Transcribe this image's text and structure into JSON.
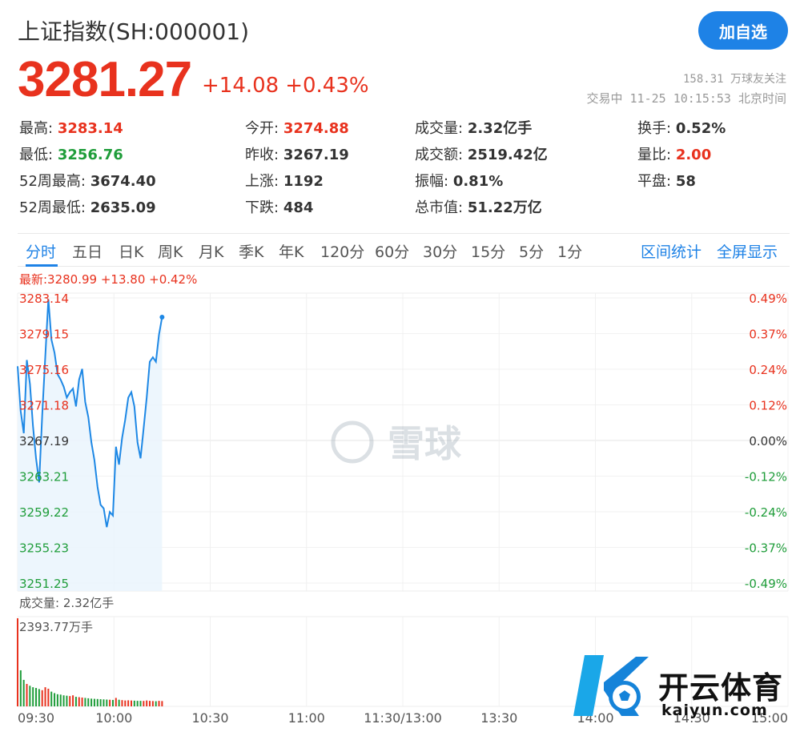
{
  "header": {
    "title": "上证指数(SH:000001)",
    "follow_button": "加自选",
    "price": "3281.27",
    "change": "+14.08",
    "change_pct": "+0.43%",
    "followers": "158.31 万球友关注",
    "status": "交易中 11-25 10:15:53 北京时间"
  },
  "stats": [
    {
      "label": "最高:",
      "value": "3283.14",
      "color": "red"
    },
    {
      "label": "今开:",
      "value": "3274.88",
      "color": "red"
    },
    {
      "label": "成交量:",
      "value": "2.32亿手",
      "color": "plain"
    },
    {
      "label": "换手:",
      "value": "0.52%",
      "color": "plain"
    },
    {
      "label": "最低:",
      "value": "3256.76",
      "color": "green"
    },
    {
      "label": "昨收:",
      "value": "3267.19",
      "color": "plain"
    },
    {
      "label": "成交额:",
      "value": "2519.42亿",
      "color": "plain"
    },
    {
      "label": "量比:",
      "value": "2.00",
      "color": "red"
    },
    {
      "label": "52周最高:",
      "value": "3674.40",
      "color": "plain"
    },
    {
      "label": "上涨:",
      "value": "1192",
      "color": "plain"
    },
    {
      "label": "振幅:",
      "value": "0.81%",
      "color": "plain"
    },
    {
      "label": "平盘:",
      "value": "58",
      "color": "plain"
    },
    {
      "label": "52周最低:",
      "value": "2635.09",
      "color": "plain"
    },
    {
      "label": "下跌:",
      "value": "484",
      "color": "plain"
    },
    {
      "label": "总市值:",
      "value": "51.22万亿",
      "color": "plain"
    }
  ],
  "tabs": [
    "分时",
    "五日",
    "日K",
    "周K",
    "月K",
    "季K",
    "年K",
    "120分",
    "60分",
    "30分",
    "15分",
    "5分",
    "1分"
  ],
  "tab_links": [
    "区间统计",
    "全屏显示"
  ],
  "latest_line": "最新:3280.99 +13.80 +0.42%",
  "volume_label": "成交量: 2.32亿手",
  "volume_max_label": "2393.77万手",
  "watermark": "雪球",
  "brand": {
    "name": "开云体育",
    "url": "kaiyun.com"
  },
  "colors": {
    "up": "#e8321e",
    "down": "#1f9d3a",
    "accent": "#1e82e6",
    "line": "#1e88e5"
  },
  "chart_data": {
    "type": "line",
    "x_ticks": [
      "09:30",
      "10:00",
      "10:30",
      "11:00",
      "11:30/13:00",
      "13:30",
      "14:00",
      "14:30",
      "15:00"
    ],
    "y_ticks_left": [
      "3283.14",
      "3279.15",
      "3275.16",
      "3271.18",
      "3267.19",
      "3263.21",
      "3259.22",
      "3255.23",
      "3251.25"
    ],
    "y_ticks_right": [
      "0.49%",
      "0.37%",
      "0.24%",
      "0.12%",
      "0.00%",
      "-0.12%",
      "-0.24%",
      "-0.37%",
      "-0.49%"
    ],
    "ylim": [
      3251.25,
      3283.14
    ],
    "prev_close": 3267.19,
    "total_minutes": 240,
    "series": [
      {
        "values": [
          3275.5,
          3270.5,
          3268.0,
          3276.2,
          3273.5,
          3268.8,
          3265.2,
          3262.5,
          3270.0,
          3276.5,
          3283.0,
          3278.5,
          3277.0,
          3274.6,
          3274.0,
          3273.2,
          3272.0,
          3272.6,
          3273.0,
          3271.0,
          3274.0,
          3275.2,
          3271.5,
          3269.8,
          3267.0,
          3265.0,
          3262.0,
          3260.0,
          3259.6,
          3257.5,
          3259.2,
          3258.8,
          3266.5,
          3264.5,
          3267.5,
          3269.5,
          3272.0,
          3272.6,
          3271.0,
          3267.0,
          3265.2,
          3268.5,
          3272.0,
          3276.0,
          3276.5,
          3276.0,
          3279.0,
          3280.99
        ]
      }
    ],
    "volume": {
      "max": 2393.77,
      "values": [
        2393.77,
        980,
        720,
        610,
        560,
        520,
        500,
        470,
        440,
        520,
        480,
        400,
        360,
        330,
        320,
        300,
        290,
        280,
        300,
        260,
        250,
        240,
        230,
        220,
        210,
        205,
        200,
        195,
        190,
        185,
        180,
        175,
        230,
        180,
        170,
        160,
        165,
        160,
        155,
        150,
        150,
        148,
        160,
        150,
        145,
        140,
        150,
        145
      ]
    }
  }
}
